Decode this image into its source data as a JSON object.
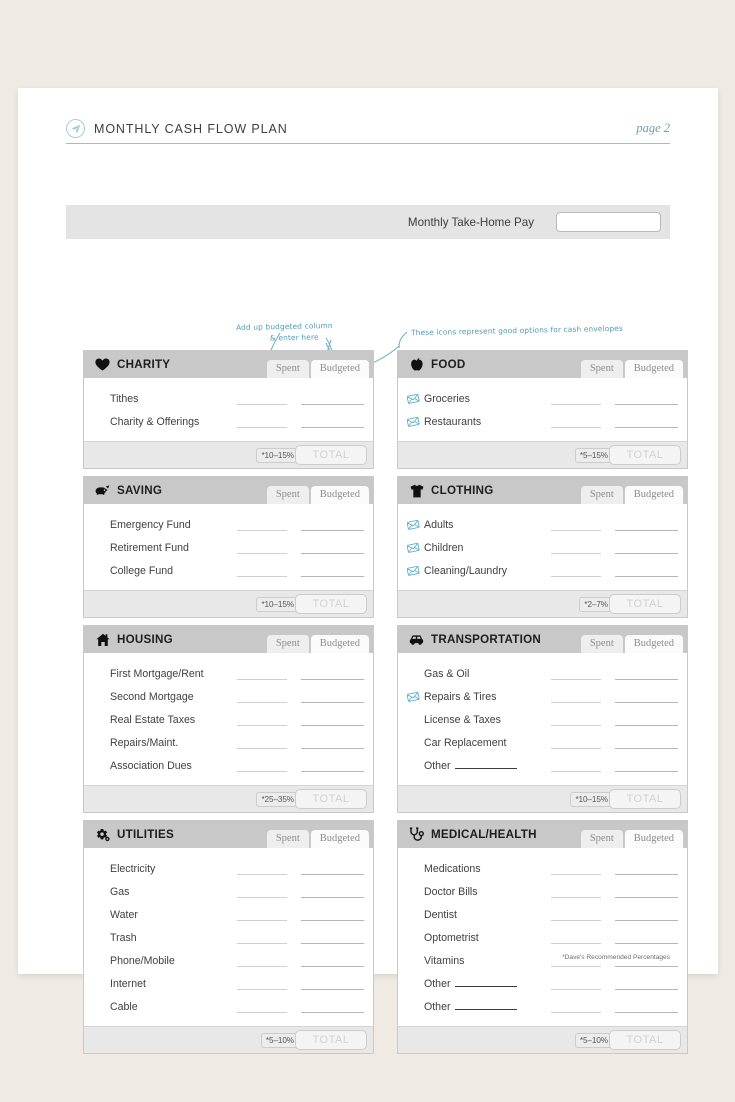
{
  "header": {
    "logo_icon": "paper-plane-icon",
    "title": "MONTHLY CASH FLOW PLAN",
    "page_label": "page 2",
    "rule_color": "#eaa584",
    "accent_color": "#6e9fb3"
  },
  "takehome": {
    "label": "Monthly Take-Home Pay",
    "value": "",
    "placeholder": ""
  },
  "annotations": {
    "budget_note_line1": "Add up budgeted column",
    "budget_note_line2": "& enter here",
    "envelope_note": "These icons represent good options for cash envelopes",
    "ink_color": "#4f9cb8"
  },
  "columns": {
    "left": [
      {
        "id": "charity",
        "title": "CHARITY",
        "icon": "heart-icon",
        "tab_spent": "Spent",
        "tab_budgeted": "Budgeted",
        "percent": "*10–15%",
        "total_label": "TOTAL",
        "rows": [
          {
            "label": "Tithes",
            "envelope": false,
            "blank": false
          },
          {
            "label": "Charity & Offerings",
            "envelope": false,
            "blank": false
          }
        ]
      },
      {
        "id": "saving",
        "title": "SAVING",
        "icon": "piggy-bank-icon",
        "tab_spent": "Spent",
        "tab_budgeted": "Budgeted",
        "percent": "*10–15%",
        "total_label": "TOTAL",
        "rows": [
          {
            "label": "Emergency Fund",
            "envelope": false,
            "blank": false
          },
          {
            "label": "Retirement Fund",
            "envelope": false,
            "blank": false
          },
          {
            "label": "College Fund",
            "envelope": false,
            "blank": false
          }
        ]
      },
      {
        "id": "housing",
        "title": "HOUSING",
        "icon": "house-icon",
        "tab_spent": "Spent",
        "tab_budgeted": "Budgeted",
        "percent": "*25–35%",
        "total_label": "TOTAL",
        "rows": [
          {
            "label": "First Mortgage/Rent",
            "envelope": false,
            "blank": false
          },
          {
            "label": "Second Mortgage",
            "envelope": false,
            "blank": false
          },
          {
            "label": "Real Estate Taxes",
            "envelope": false,
            "blank": false
          },
          {
            "label": "Repairs/Maint.",
            "envelope": false,
            "blank": false
          },
          {
            "label": "Association Dues",
            "envelope": false,
            "blank": false
          }
        ]
      },
      {
        "id": "utilities",
        "title": "UTILITIES",
        "icon": "gears-icon",
        "tab_spent": "Spent",
        "tab_budgeted": "Budgeted",
        "percent": "*5–10%",
        "total_label": "TOTAL",
        "rows": [
          {
            "label": "Electricity",
            "envelope": false,
            "blank": false
          },
          {
            "label": "Gas",
            "envelope": false,
            "blank": false
          },
          {
            "label": "Water",
            "envelope": false,
            "blank": false
          },
          {
            "label": "Trash",
            "envelope": false,
            "blank": false
          },
          {
            "label": "Phone/Mobile",
            "envelope": false,
            "blank": false
          },
          {
            "label": "Internet",
            "envelope": false,
            "blank": false
          },
          {
            "label": "Cable",
            "envelope": false,
            "blank": false
          }
        ]
      }
    ],
    "right": [
      {
        "id": "food",
        "title": "FOOD",
        "icon": "apple-icon",
        "tab_spent": "Spent",
        "tab_budgeted": "Budgeted",
        "percent": "*5–15%",
        "total_label": "TOTAL",
        "rows": [
          {
            "label": "Groceries",
            "envelope": true,
            "blank": false
          },
          {
            "label": "Restaurants",
            "envelope": true,
            "blank": false
          }
        ]
      },
      {
        "id": "clothing",
        "title": "CLOTHING",
        "icon": "tshirt-icon",
        "tab_spent": "Spent",
        "tab_budgeted": "Budgeted",
        "percent": "*2–7%",
        "total_label": "TOTAL",
        "rows": [
          {
            "label": "Adults",
            "envelope": true,
            "blank": false
          },
          {
            "label": "Children",
            "envelope": true,
            "blank": false
          },
          {
            "label": "Cleaning/Laundry",
            "envelope": true,
            "blank": false
          }
        ]
      },
      {
        "id": "transportation",
        "title": "TRANSPORTATION",
        "icon": "car-icon",
        "tab_spent": "Spent",
        "tab_budgeted": "Budgeted",
        "percent": "*10–15%",
        "total_label": "TOTAL",
        "rows": [
          {
            "label": "Gas & Oil",
            "envelope": false,
            "blank": false
          },
          {
            "label": "Repairs & Tires",
            "envelope": true,
            "blank": false
          },
          {
            "label": "License & Taxes",
            "envelope": false,
            "blank": false
          },
          {
            "label": "Car Replacement",
            "envelope": false,
            "blank": false
          },
          {
            "label": "Other",
            "envelope": false,
            "blank": true
          }
        ]
      },
      {
        "id": "medical-health",
        "title": "MEDICAL/HEALTH",
        "icon": "stethoscope-icon",
        "tab_spent": "Spent",
        "tab_budgeted": "Budgeted",
        "percent": "*5–10%",
        "total_label": "TOTAL",
        "rows": [
          {
            "label": "Medications",
            "envelope": false,
            "blank": false
          },
          {
            "label": "Doctor Bills",
            "envelope": false,
            "blank": false
          },
          {
            "label": "Dentist",
            "envelope": false,
            "blank": false
          },
          {
            "label": "Optometrist",
            "envelope": false,
            "blank": false
          },
          {
            "label": "Vitamins",
            "envelope": false,
            "blank": false
          },
          {
            "label": "Other",
            "envelope": false,
            "blank": true
          },
          {
            "label": "Other",
            "envelope": false,
            "blank": true
          }
        ]
      }
    ]
  },
  "footnote": "*Dave's Recommended Percentages"
}
